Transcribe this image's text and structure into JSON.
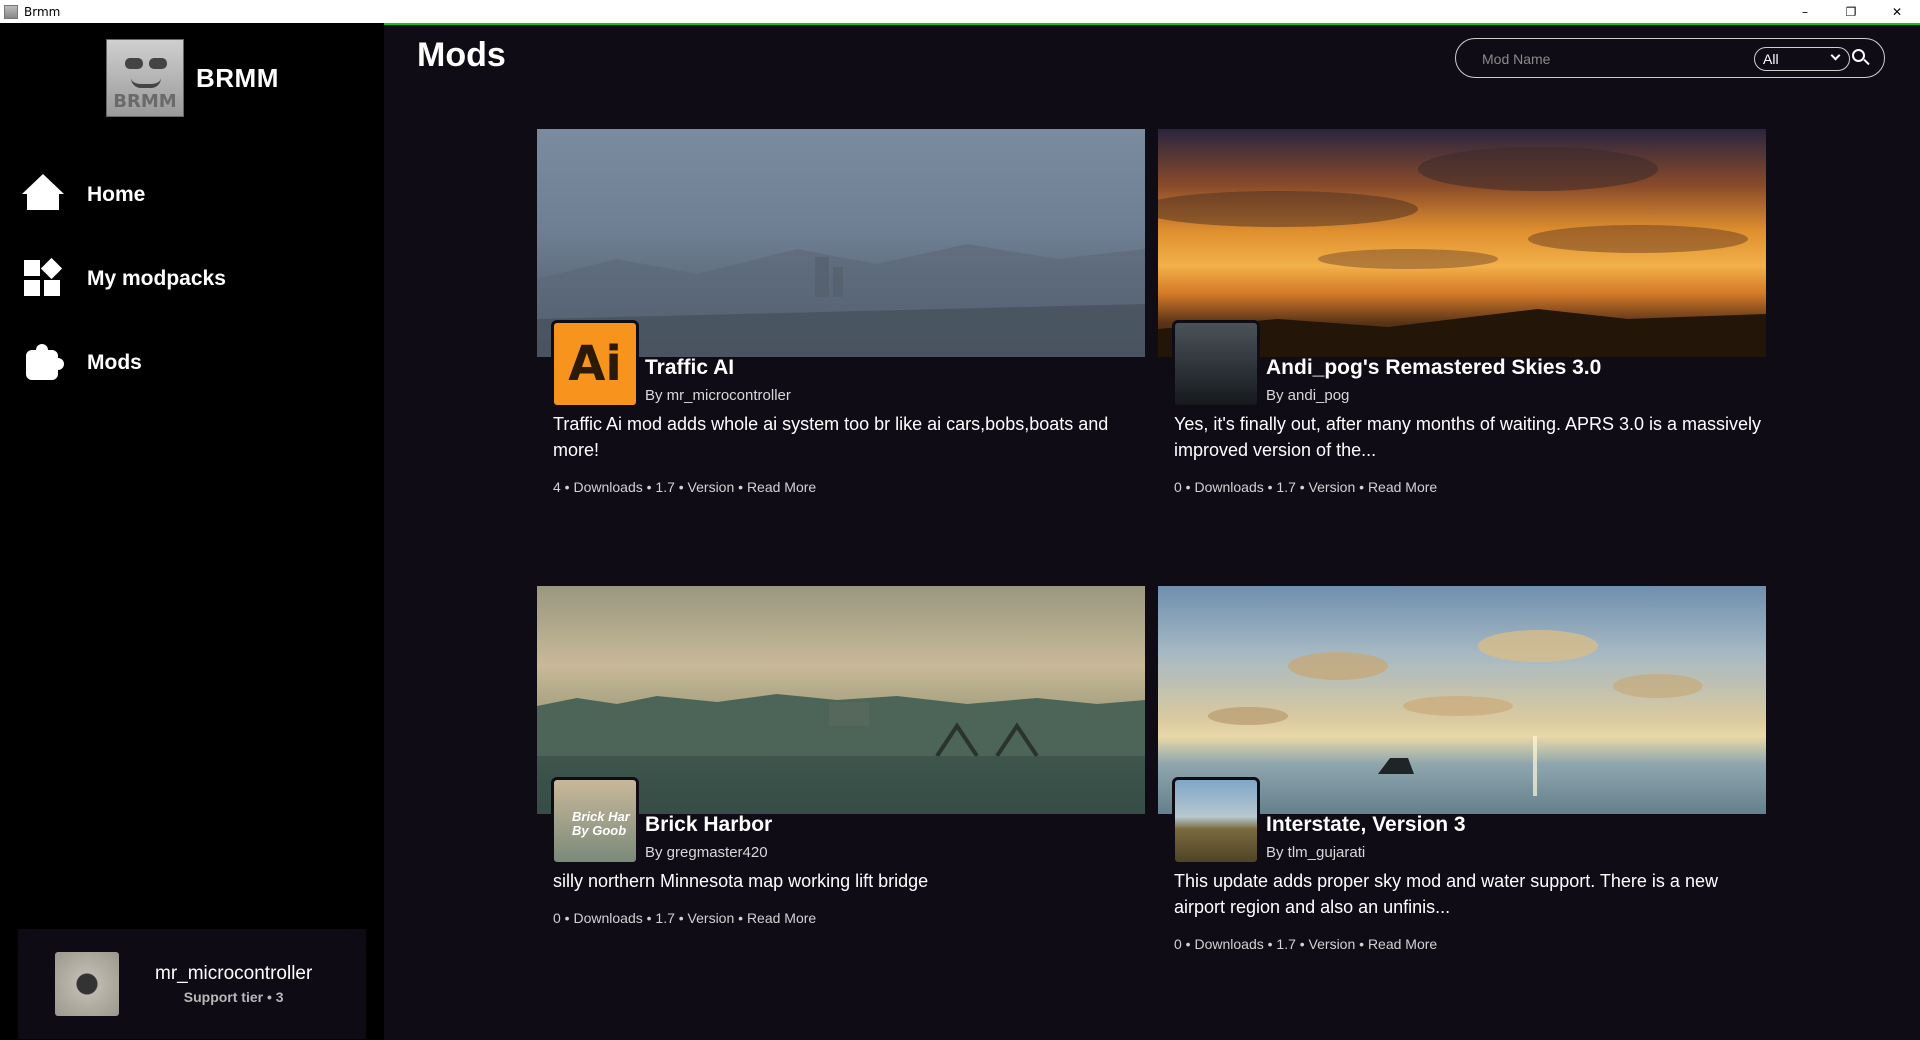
{
  "window": {
    "title": "Brmm",
    "controls": [
      "–",
      "❐",
      "✕"
    ]
  },
  "sidebar": {
    "brand_name": "BRMM",
    "logo_text": "BRMM",
    "nav": [
      {
        "label": "Home",
        "icon": "home-icon"
      },
      {
        "label": "My modpacks",
        "icon": "grid-icon"
      },
      {
        "label": "Mods",
        "icon": "puzzle-icon"
      }
    ],
    "user": {
      "name": "mr_microcontroller",
      "tier": "Support tier • 3"
    }
  },
  "main": {
    "title": "Mods",
    "search": {
      "placeholder": "Mod Name",
      "filter_value": "All"
    },
    "cards": [
      {
        "title": "Traffic AI",
        "author": "By mr_microcontroller",
        "description": "Traffic Ai mod adds whole ai system too br like ai cars,bobs,boats and more!",
        "meta": "4 • Downloads • 1.7 • Version • ",
        "read_more": "Read More",
        "thumb_text": "Ai"
      },
      {
        "title": "Andi_pog's Remastered Skies 3.0",
        "author": "By andi_pog",
        "description": "Yes, it's finally out, after many months of waiting. APRS 3.0 is a massively improved version of the...",
        "meta": "0 • Downloads • 1.7 • Version • ",
        "read_more": "Read More"
      },
      {
        "title": "Brick Harbor",
        "author": "By gregmaster420",
        "description": "silly northern Minnesota map working lift bridge",
        "meta": "0 • Downloads • 1.7 • Version • ",
        "read_more": "Read More",
        "thumb_text": "Brick Har By Goob"
      },
      {
        "title": "Interstate, Version 3",
        "author": "By tlm_gujarati",
        "description": "This update adds proper sky mod and water support. There is a new airport region and also an unfinis...",
        "meta": "0 • Downloads • 1.7 • Version • ",
        "read_more": "Read More"
      }
    ]
  },
  "colors": {
    "background": "#0f0c16",
    "sidebar": "#000000",
    "accent_line": "#16c216",
    "traffic_ai_orange": "#f7941d"
  }
}
